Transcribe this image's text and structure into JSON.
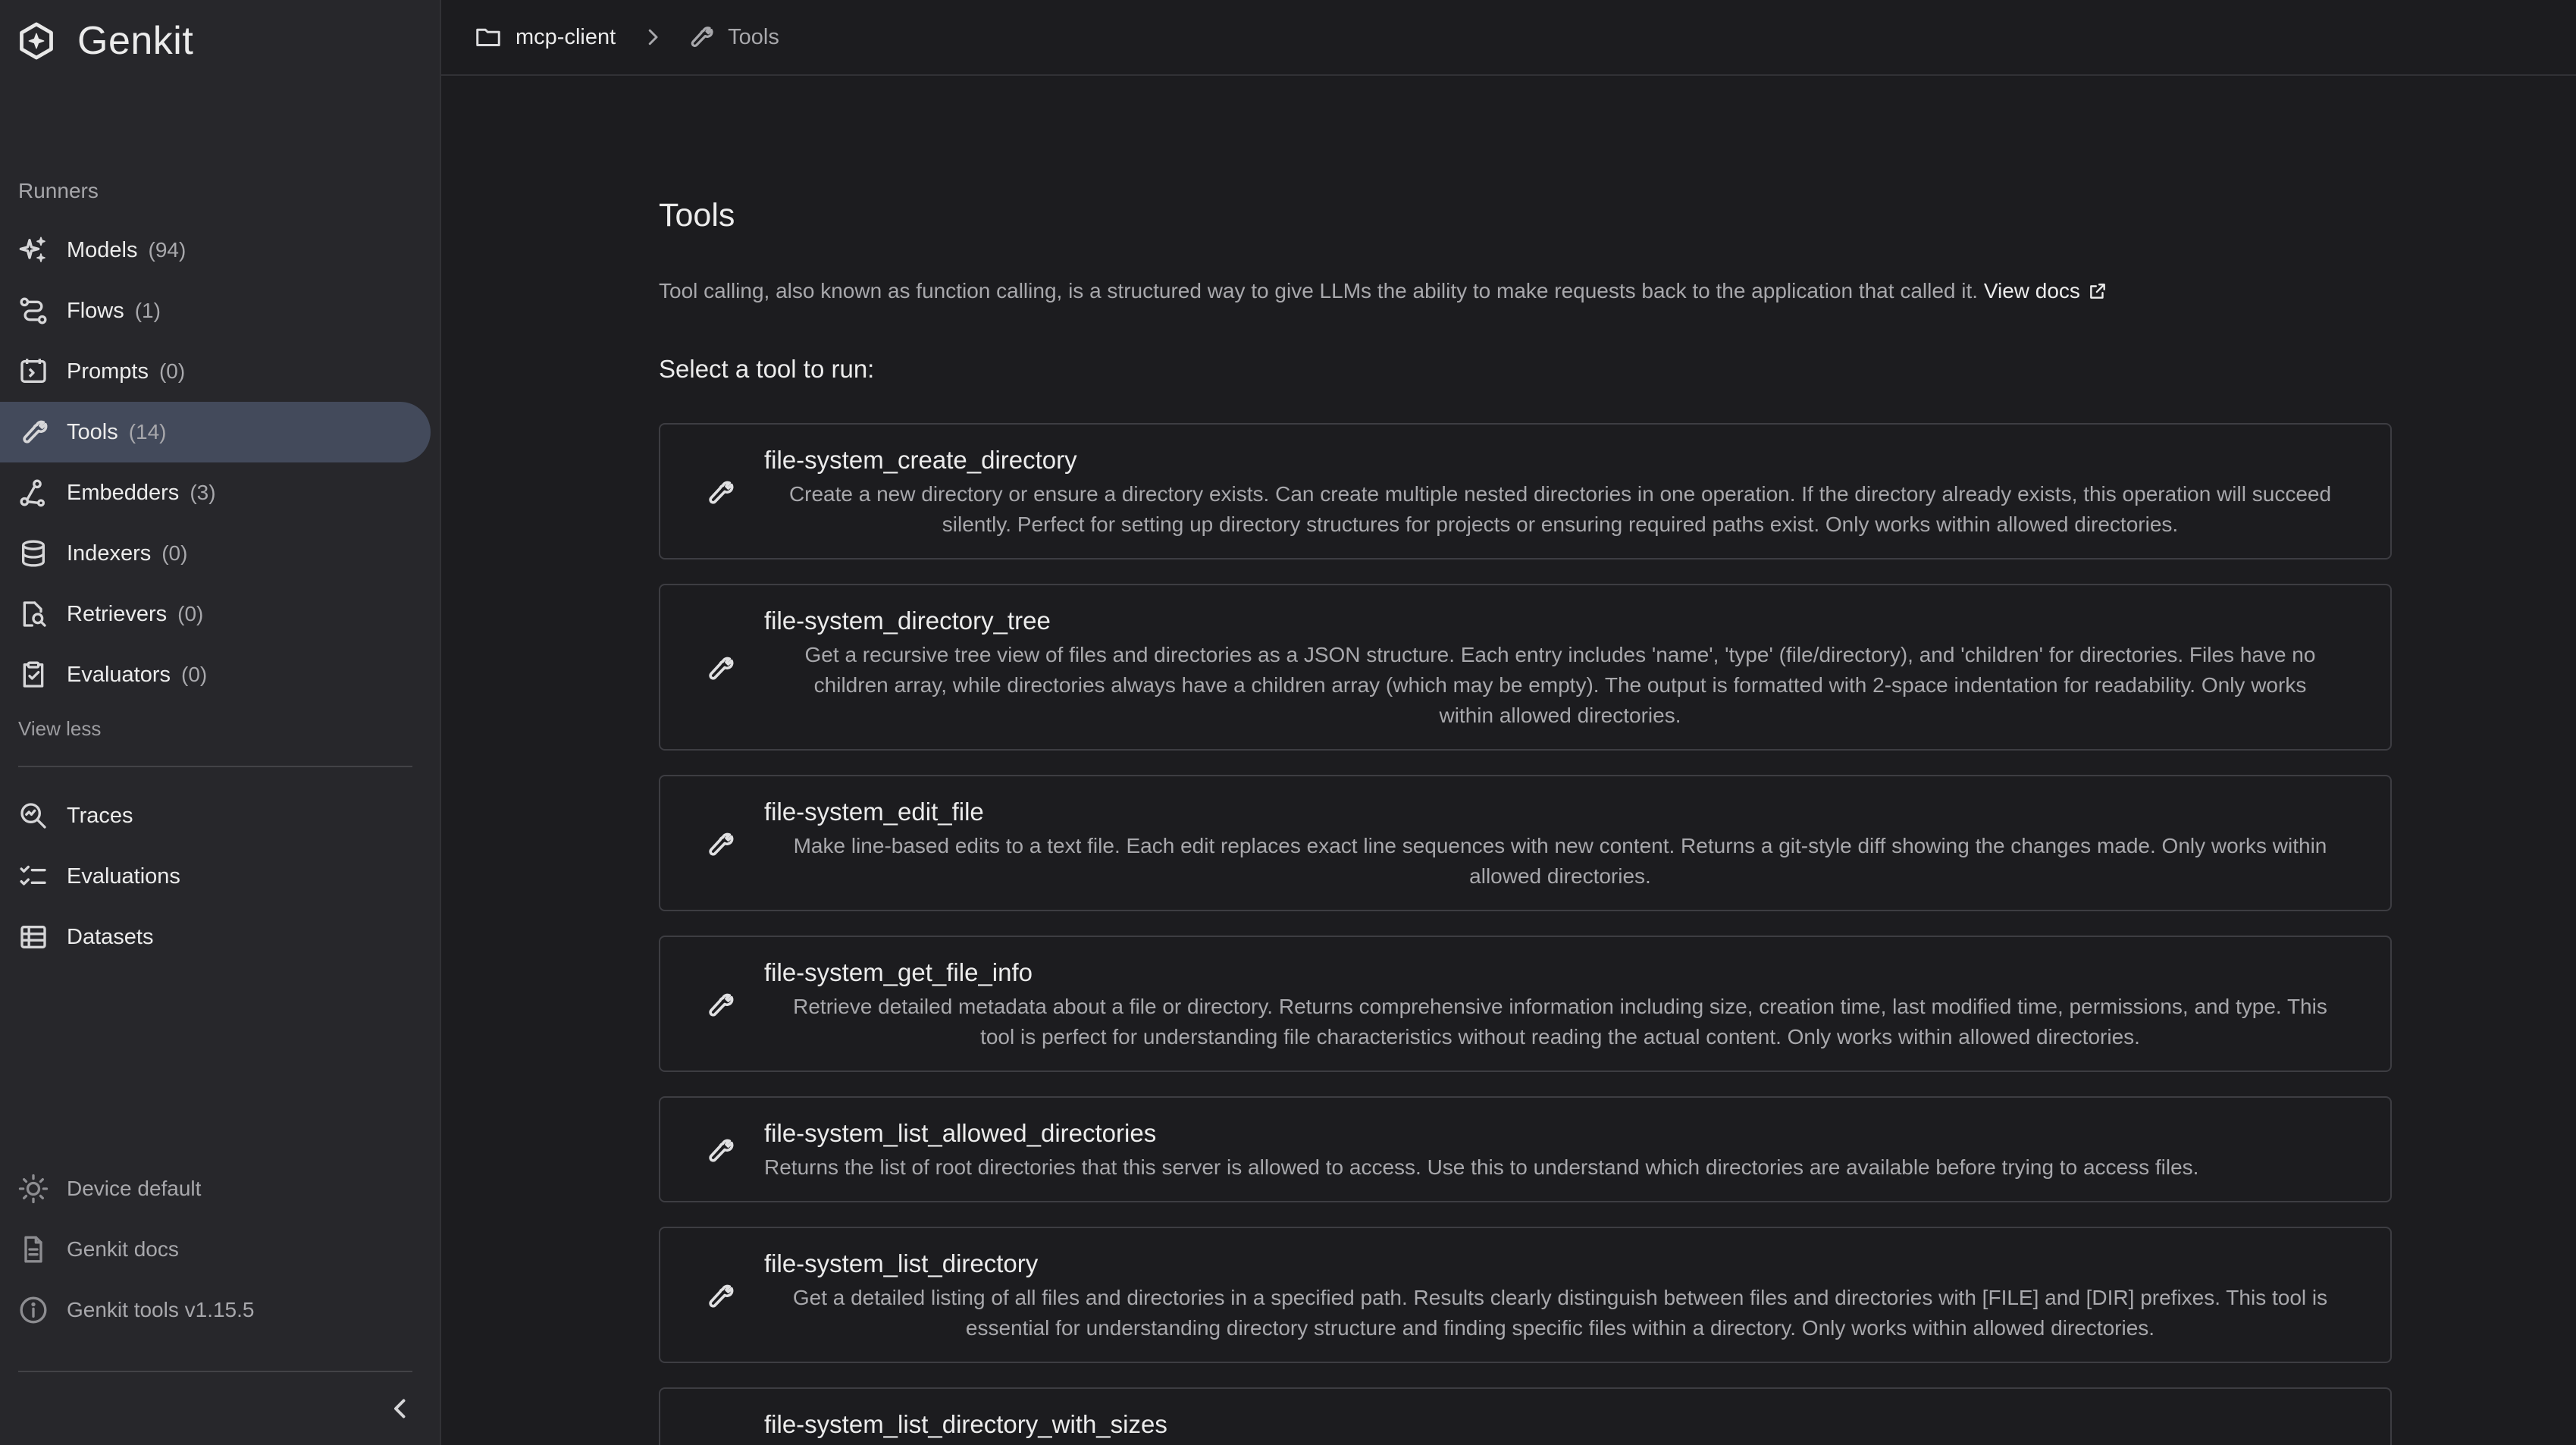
{
  "app": {
    "name": "Genkit"
  },
  "sidebar": {
    "section_label": "Runners",
    "runners": [
      {
        "label": "Models",
        "count": "(94)",
        "icon": "sparkle-icon"
      },
      {
        "label": "Flows",
        "count": "(1)",
        "icon": "flow-icon"
      },
      {
        "label": "Prompts",
        "count": "(0)",
        "icon": "prompt-icon"
      },
      {
        "label": "Tools",
        "count": "(14)",
        "icon": "wrench-icon",
        "active": true
      },
      {
        "label": "Embedders",
        "count": "(3)",
        "icon": "embedder-icon"
      },
      {
        "label": "Indexers",
        "count": "(0)",
        "icon": "database-icon"
      },
      {
        "label": "Retrievers",
        "count": "(0)",
        "icon": "retriever-icon"
      },
      {
        "label": "Evaluators",
        "count": "(0)",
        "icon": "evaluator-icon"
      }
    ],
    "view_less": "View less",
    "secondary": [
      {
        "label": "Traces",
        "icon": "trace-search-icon"
      },
      {
        "label": "Evaluations",
        "icon": "checklist-icon"
      },
      {
        "label": "Datasets",
        "icon": "table-icon"
      }
    ],
    "footer": [
      {
        "label": "Device default",
        "icon": "brightness-icon"
      },
      {
        "label": "Genkit docs",
        "icon": "document-icon"
      },
      {
        "label": "Genkit tools v1.15.5",
        "icon": "info-icon"
      }
    ]
  },
  "breadcrumb": {
    "project": "mcp-client",
    "current": "Tools"
  },
  "main": {
    "title": "Tools",
    "description": "Tool calling, also known as function calling, is a structured way to give LLMs the ability to make requests back to the application that called it.",
    "view_docs": "View docs",
    "select_prompt": "Select a tool to run:",
    "tools": [
      {
        "name": "file-system_create_directory",
        "lines": [
          "Create a new directory or ensure a directory exists. Can create multiple nested directories in one operation. If the directory already exists, this operation will succeed",
          "silently. Perfect for setting up directory structures for projects or ensuring required paths exist. Only works within allowed directories."
        ]
      },
      {
        "name": "file-system_directory_tree",
        "lines": [
          "Get a recursive tree view of files and directories as a JSON structure. Each entry includes 'name', 'type' (file/directory), and 'children' for directories. Files have no",
          "children array, while directories always have a children array (which may be empty). The output is formatted with 2-space indentation for readability. Only works",
          "within allowed directories."
        ]
      },
      {
        "name": "file-system_edit_file",
        "lines": [
          "Make line-based edits to a text file. Each edit replaces exact line sequences with new content. Returns a git-style diff showing the changes made. Only works within",
          "allowed directories."
        ]
      },
      {
        "name": "file-system_get_file_info",
        "lines": [
          "Retrieve detailed metadata about a file or directory. Returns comprehensive information including size, creation time, last modified time, permissions, and type. This",
          "tool is perfect for understanding file characteristics without reading the actual content. Only works within allowed directories."
        ]
      },
      {
        "name": "file-system_list_allowed_directories",
        "lines": [
          "Returns the list of root directories that this server is allowed to access. Use this to understand which directories are available before trying to access files."
        ]
      },
      {
        "name": "file-system_list_directory",
        "lines": [
          "Get a detailed listing of all files and directories in a specified path. Results clearly distinguish between files and directories with [FILE] and [DIR] prefixes. This tool is",
          "essential for understanding directory structure and finding specific files within a directory. Only works within allowed directories."
        ]
      },
      {
        "name": "file-system_list_directory_with_sizes",
        "lines": []
      }
    ]
  }
}
